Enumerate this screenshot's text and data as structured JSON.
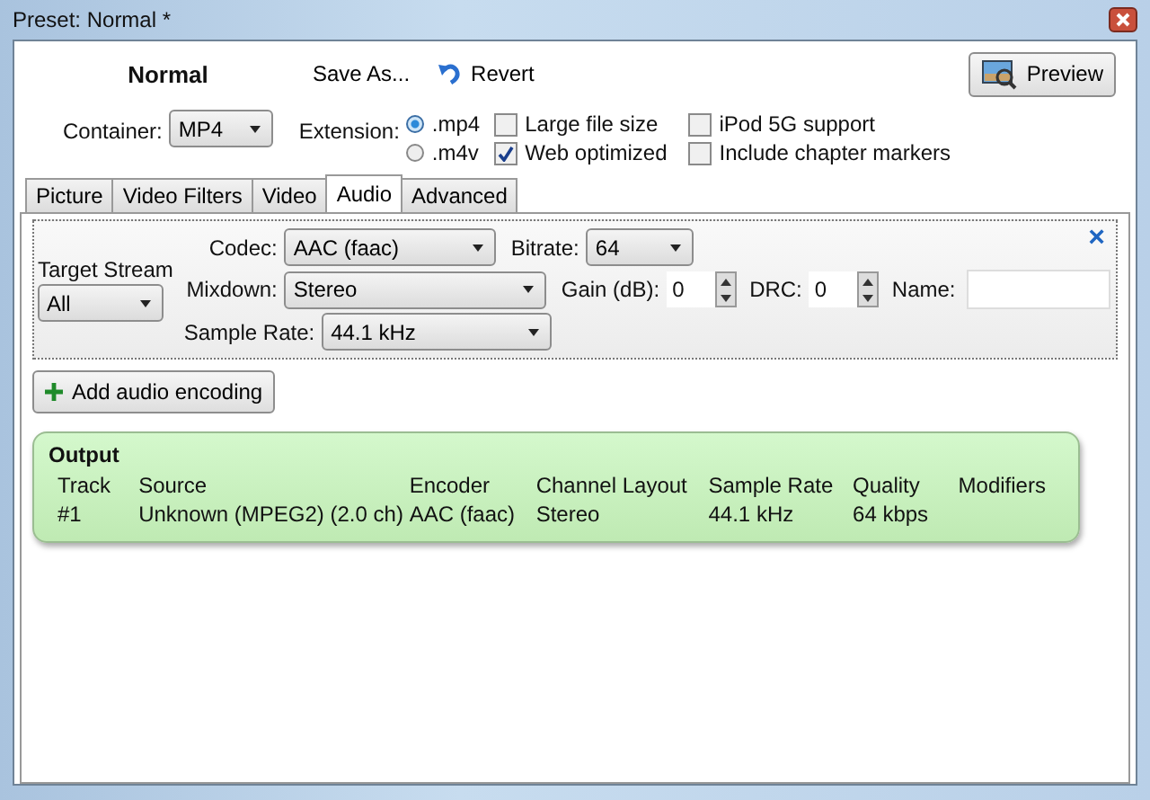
{
  "window": {
    "title": "Preset: Normal *"
  },
  "toolbar": {
    "preset_name": "Normal",
    "save_as": "Save As...",
    "revert": "Revert",
    "preview": "Preview"
  },
  "container": {
    "label": "Container:",
    "value": "MP4"
  },
  "extension": {
    "label": "Extension:",
    "options": [
      {
        "label": ".mp4",
        "selected": true
      },
      {
        "label": ".m4v",
        "selected": false
      }
    ]
  },
  "options": [
    {
      "label": "Large file size",
      "checked": false
    },
    {
      "label": "Web optimized",
      "checked": true
    },
    {
      "label": "iPod 5G support",
      "checked": false
    },
    {
      "label": "Include chapter markers",
      "checked": false
    }
  ],
  "tabs": [
    {
      "label": "Picture",
      "selected": false
    },
    {
      "label": "Video Filters",
      "selected": false
    },
    {
      "label": "Video",
      "selected": false
    },
    {
      "label": "Audio",
      "selected": true
    },
    {
      "label": "Advanced",
      "selected": false
    }
  ],
  "audio_track": {
    "target_stream": {
      "label": "Target Stream",
      "value": "All"
    },
    "codec": {
      "label": "Codec:",
      "value": "AAC (faac)"
    },
    "mixdown": {
      "label": "Mixdown:",
      "value": "Stereo"
    },
    "sample_rate": {
      "label": "Sample Rate:",
      "value": "44.1 kHz"
    },
    "bitrate": {
      "label": "Bitrate:",
      "value": "64"
    },
    "gain": {
      "label": "Gain (dB):",
      "value": "0"
    },
    "drc": {
      "label": "DRC:",
      "value": "0"
    },
    "name": {
      "label": "Name:"
    },
    "remove": "×"
  },
  "add_button": "Add audio encoding",
  "output": {
    "title": "Output",
    "columns": [
      "Track",
      "Source",
      "Encoder",
      "Channel Layout",
      "Sample Rate",
      "Quality",
      "Modifiers"
    ],
    "rows": [
      [
        "#1",
        "Unknown (MPEG2) (2.0 ch)",
        "AAC (faac)",
        "Stereo",
        "44.1 kHz",
        "64 kbps",
        ""
      ]
    ]
  }
}
